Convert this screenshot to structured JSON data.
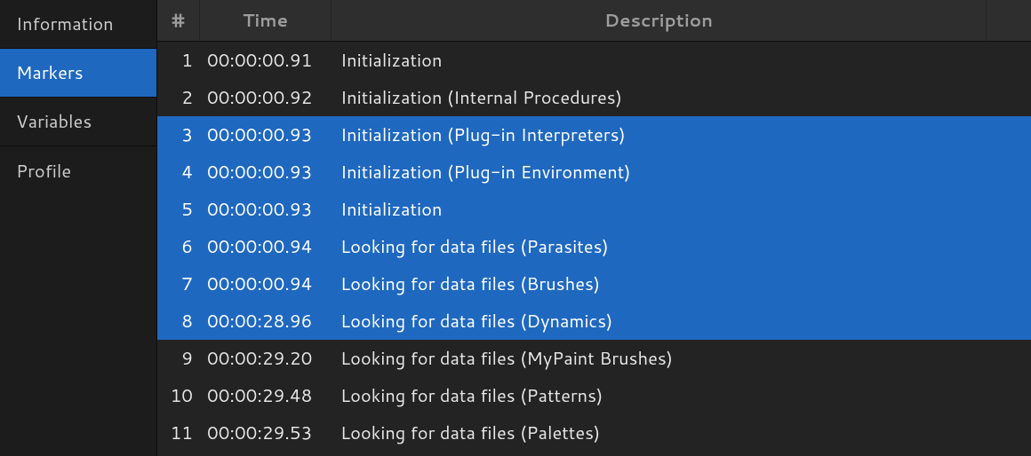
{
  "sidebar": {
    "items": [
      {
        "label": "Information"
      },
      {
        "label": "Markers"
      },
      {
        "label": "Variables"
      },
      {
        "label": "Profile"
      }
    ],
    "active_index": 1
  },
  "table": {
    "headers": {
      "num": "#",
      "time": "Time",
      "desc": "Description"
    },
    "rows": [
      {
        "n": "1",
        "time": "00:00:00.91",
        "desc": "Initialization"
      },
      {
        "n": "2",
        "time": "00:00:00.92",
        "desc": "Initialization (Internal Procedures)"
      },
      {
        "n": "3",
        "time": "00:00:00.93",
        "desc": "Initialization (Plug-in Interpreters)"
      },
      {
        "n": "4",
        "time": "00:00:00.93",
        "desc": "Initialization (Plug-in Environment)"
      },
      {
        "n": "5",
        "time": "00:00:00.93",
        "desc": "Initialization"
      },
      {
        "n": "6",
        "time": "00:00:00.94",
        "desc": "Looking for data files (Parasites)"
      },
      {
        "n": "7",
        "time": "00:00:00.94",
        "desc": "Looking for data files (Brushes)"
      },
      {
        "n": "8",
        "time": "00:00:28.96",
        "desc": "Looking for data files (Dynamics)"
      },
      {
        "n": "9",
        "time": "00:00:29.20",
        "desc": "Looking for data files (MyPaint Brushes)"
      },
      {
        "n": "10",
        "time": "00:00:29.48",
        "desc": "Looking for data files (Patterns)"
      },
      {
        "n": "11",
        "time": "00:00:29.53",
        "desc": "Looking for data files (Palettes)"
      }
    ],
    "selected_start": 2,
    "selected_end": 7
  }
}
